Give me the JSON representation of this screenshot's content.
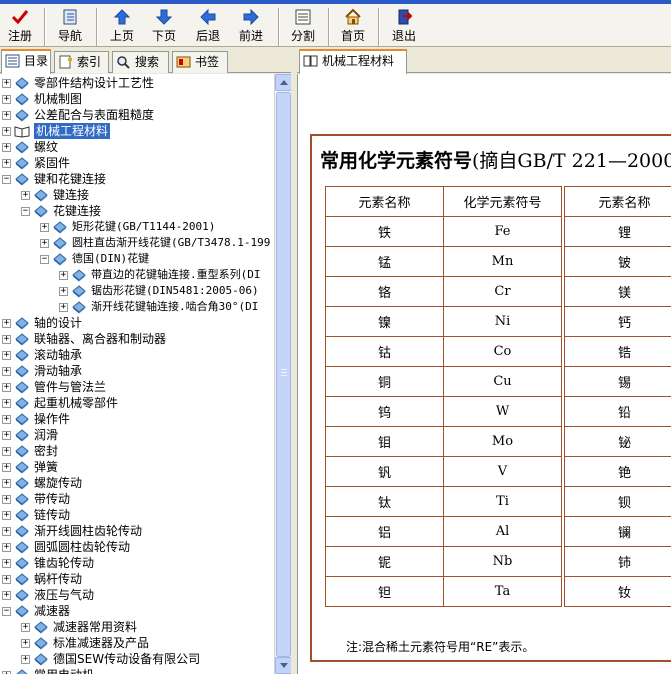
{
  "toolbar": {
    "buttons": [
      {
        "label": "注册",
        "icon": "checkmark-icon"
      },
      {
        "label": "导航",
        "icon": "navigation-icon"
      },
      {
        "label": "上页",
        "icon": "arrow-up-icon"
      },
      {
        "label": "下页",
        "icon": "arrow-down-icon"
      },
      {
        "label": "后退",
        "icon": "arrow-left-icon"
      },
      {
        "label": "前进",
        "icon": "arrow-right-icon"
      },
      {
        "label": "分割",
        "icon": "split-icon"
      },
      {
        "label": "首页",
        "icon": "home-icon"
      },
      {
        "label": "退出",
        "icon": "exit-icon"
      }
    ]
  },
  "left_tabs": [
    {
      "label": "目录",
      "icon": "contents-icon",
      "active": true
    },
    {
      "label": "索引",
      "icon": "index-icon",
      "active": false
    },
    {
      "label": "搜索",
      "icon": "search-icon",
      "active": false
    },
    {
      "label": "书签",
      "icon": "bookmark-icon",
      "active": false
    }
  ],
  "tree": [
    {
      "label": "零部件结构设计工艺性",
      "level": 0,
      "state": "collapsed"
    },
    {
      "label": "机械制图",
      "level": 0,
      "state": "collapsed"
    },
    {
      "label": "公差配合与表面粗糙度",
      "level": 0,
      "state": "collapsed"
    },
    {
      "label": "机械工程材料",
      "level": 0,
      "state": "collapsed",
      "selected": true
    },
    {
      "label": "螺纹",
      "level": 0,
      "state": "collapsed"
    },
    {
      "label": "紧固件",
      "level": 0,
      "state": "collapsed"
    },
    {
      "label": "键和花键连接",
      "level": 0,
      "state": "expanded"
    },
    {
      "label": "键连接",
      "level": 1,
      "state": "collapsed"
    },
    {
      "label": "花键连接",
      "level": 1,
      "state": "expanded"
    },
    {
      "label": "矩形花键(GB/T1144-2001)",
      "level": 2,
      "state": "collapsed"
    },
    {
      "label": "圆柱直齿渐开线花键(GB/T3478.1-199",
      "level": 2,
      "state": "collapsed"
    },
    {
      "label": "德国(DIN)花键",
      "level": 2,
      "state": "expanded"
    },
    {
      "label": "带直边的花键轴连接.重型系列(DI",
      "level": 3,
      "state": "collapsed"
    },
    {
      "label": "锯齿形花键(DIN5481:2005-06)",
      "level": 3,
      "state": "collapsed"
    },
    {
      "label": "渐开线花键轴连接.啮合角30°(DI",
      "level": 3,
      "state": "collapsed"
    },
    {
      "label": "轴的设计",
      "level": 0,
      "state": "collapsed"
    },
    {
      "label": "联轴器、离合器和制动器",
      "level": 0,
      "state": "collapsed"
    },
    {
      "label": "滚动轴承",
      "level": 0,
      "state": "collapsed"
    },
    {
      "label": "滑动轴承",
      "level": 0,
      "state": "collapsed"
    },
    {
      "label": "管件与管法兰",
      "level": 0,
      "state": "collapsed"
    },
    {
      "label": "起重机械零部件",
      "level": 0,
      "state": "collapsed"
    },
    {
      "label": "操作件",
      "level": 0,
      "state": "collapsed"
    },
    {
      "label": "润滑",
      "level": 0,
      "state": "collapsed"
    },
    {
      "label": "密封",
      "level": 0,
      "state": "collapsed"
    },
    {
      "label": "弹簧",
      "level": 0,
      "state": "collapsed"
    },
    {
      "label": "螺旋传动",
      "level": 0,
      "state": "collapsed"
    },
    {
      "label": "带传动",
      "level": 0,
      "state": "collapsed"
    },
    {
      "label": "链传动",
      "level": 0,
      "state": "collapsed"
    },
    {
      "label": "渐开线圆柱齿轮传动",
      "level": 0,
      "state": "collapsed"
    },
    {
      "label": "圆弧圆柱齿轮传动",
      "level": 0,
      "state": "collapsed"
    },
    {
      "label": "锥齿轮传动",
      "level": 0,
      "state": "collapsed"
    },
    {
      "label": "蜗杆传动",
      "level": 0,
      "state": "collapsed"
    },
    {
      "label": "液压与气动",
      "level": 0,
      "state": "collapsed"
    },
    {
      "label": "减速器",
      "level": 0,
      "state": "expanded"
    },
    {
      "label": "减速器常用资料",
      "level": 1,
      "state": "collapsed"
    },
    {
      "label": "标准减速器及产品",
      "level": 1,
      "state": "collapsed"
    },
    {
      "label": "德国SEW传动设备有限公司",
      "level": 1,
      "state": "collapsed"
    },
    {
      "label": "常用电动机",
      "level": 0,
      "state": "collapsed"
    }
  ],
  "right_tab": {
    "label": "机械工程材料",
    "icon": "book-icon"
  },
  "document": {
    "title_bold": "常用化学元素符号",
    "title_rest": "(摘自GB/T 221—2000",
    "headers": [
      "元素名称",
      "化学元素符号",
      "元素名称"
    ],
    "rows": [
      [
        "铁",
        "Fe",
        "锂"
      ],
      [
        "锰",
        "Mn",
        "铍"
      ],
      [
        "铬",
        "Cr",
        "镁"
      ],
      [
        "镍",
        "Ni",
        "钙"
      ],
      [
        "钴",
        "Co",
        "锆"
      ],
      [
        "铜",
        "Cu",
        "锡"
      ],
      [
        "钨",
        "W",
        "铅"
      ],
      [
        "钼",
        "Mo",
        "铋"
      ],
      [
        "钒",
        "V",
        "铯"
      ],
      [
        "钛",
        "Ti",
        "钡"
      ],
      [
        "铝",
        "Al",
        "镧"
      ],
      [
        "铌",
        "Nb",
        "铈"
      ],
      [
        "钽",
        "Ta",
        "钕"
      ]
    ],
    "note": "注:混合稀土元素符号用“RE”表示。"
  },
  "colors": {
    "selection": "#316ac5",
    "table_border": "#a0522d",
    "tab_highlight": "#e68b2c"
  }
}
